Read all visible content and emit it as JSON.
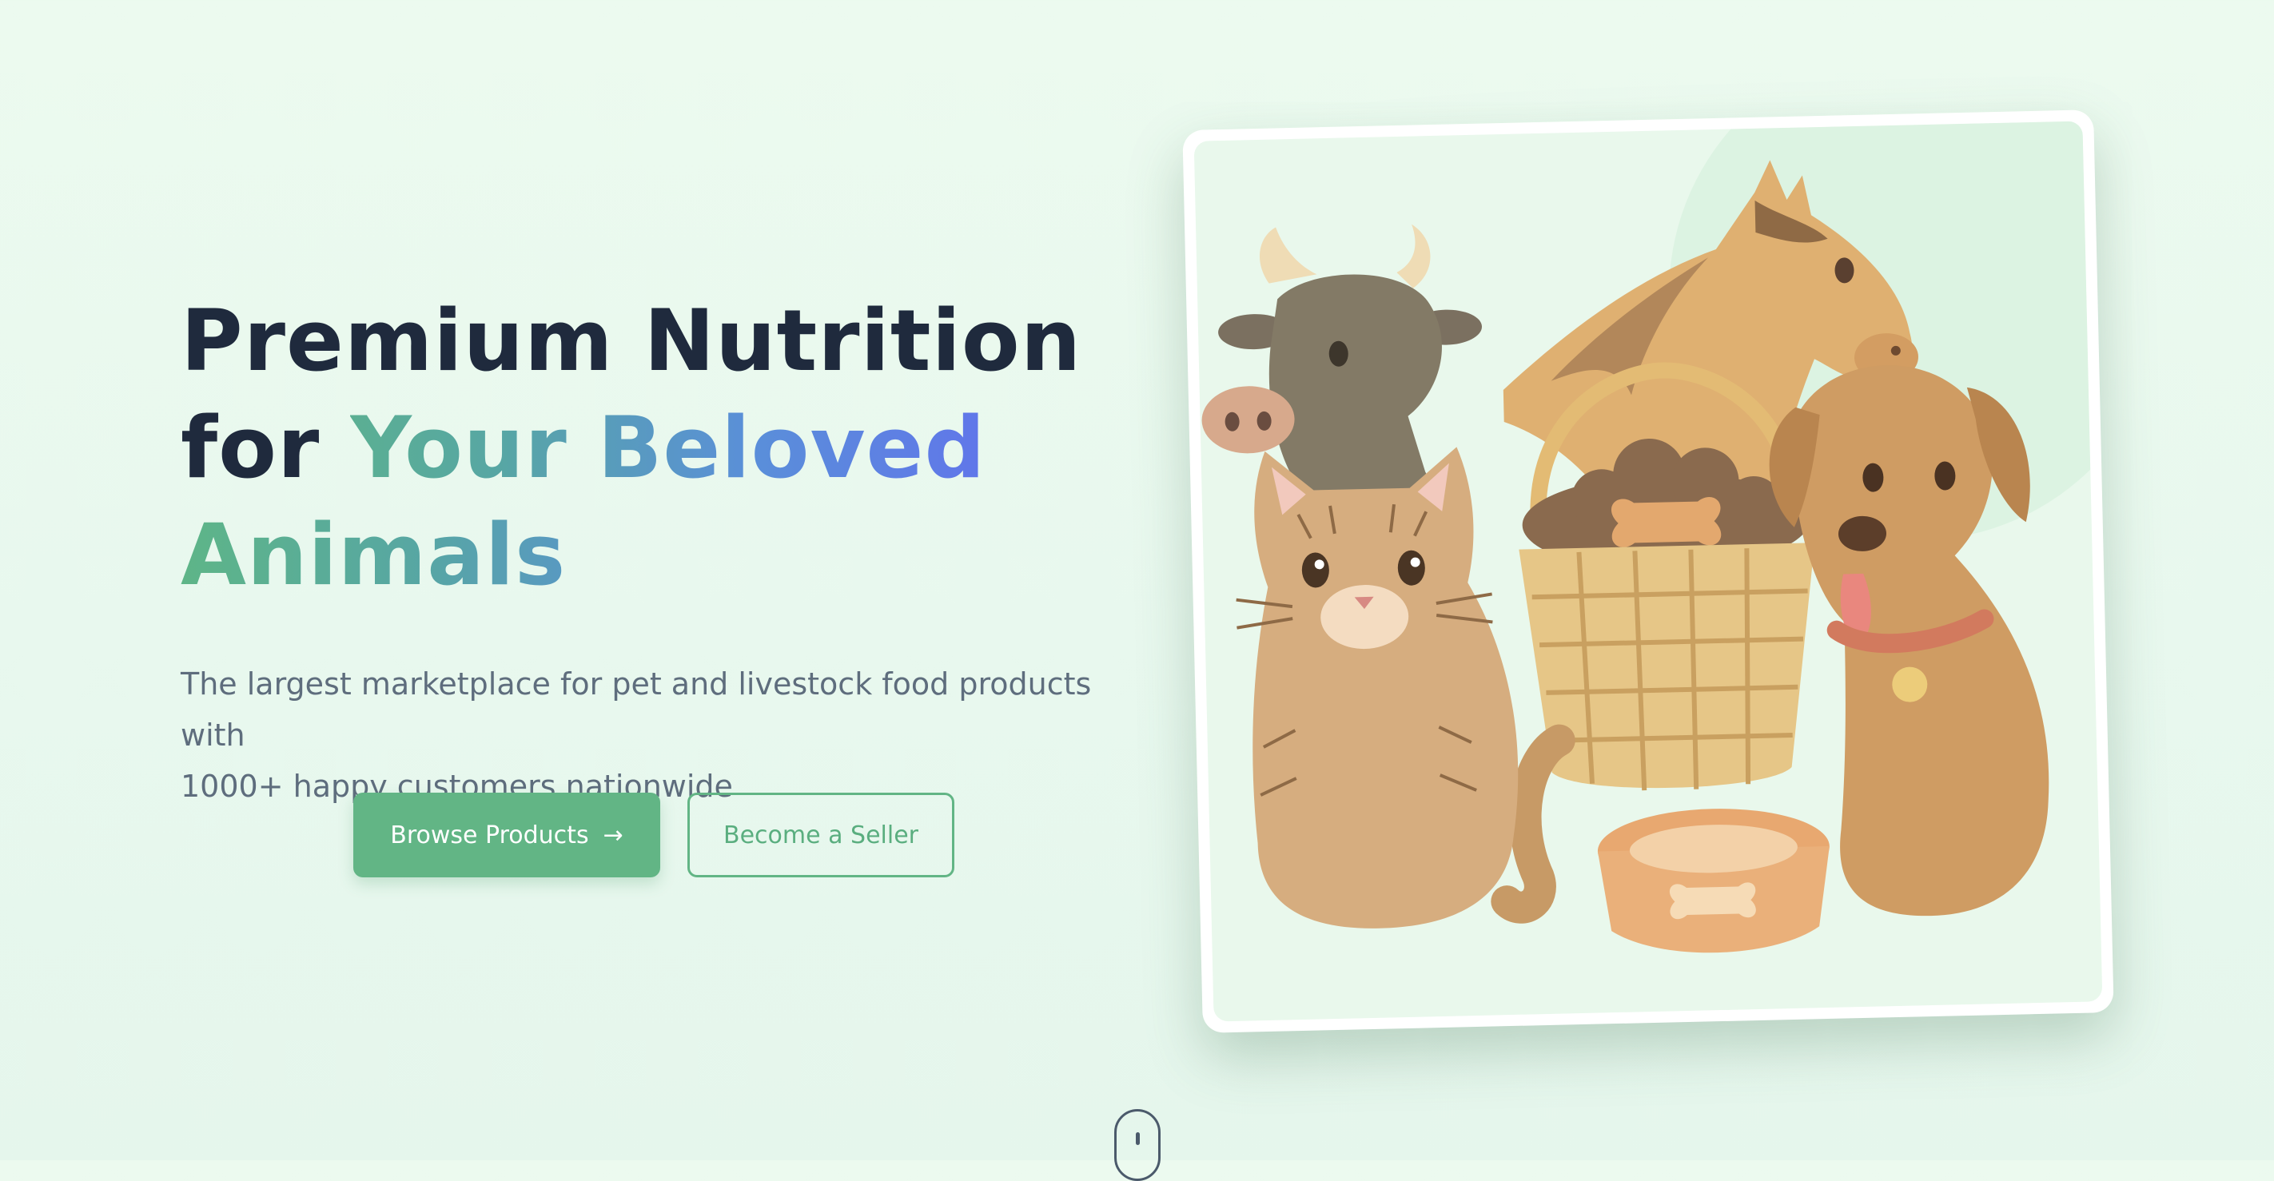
{
  "hero": {
    "title_line1": "Premium Nutrition",
    "title_line2_plain": "for ",
    "title_line2_accent": "Your Beloved",
    "title_line3_accent": "Animals",
    "subtitle_line1": "The largest marketplace for pet and livestock food products with",
    "subtitle_line2": "1000+ happy customers nationwide"
  },
  "actions": {
    "browse_label": "Browse Products",
    "browse_icon": "arrow-right-icon",
    "seller_label": "Become a Seller"
  },
  "illustration": {
    "subjects": [
      "cow",
      "horse",
      "cat",
      "dog",
      "food-basket",
      "food-bowl"
    ]
  },
  "scroll_indicator": {
    "icon": "mouse-scroll-icon"
  },
  "colors": {
    "heading": "#1f2a3d",
    "accent_green": "#62b585",
    "accent_blue": "#6270ee",
    "subtitle": "#5e6d7d",
    "background": "#ecfaef"
  }
}
